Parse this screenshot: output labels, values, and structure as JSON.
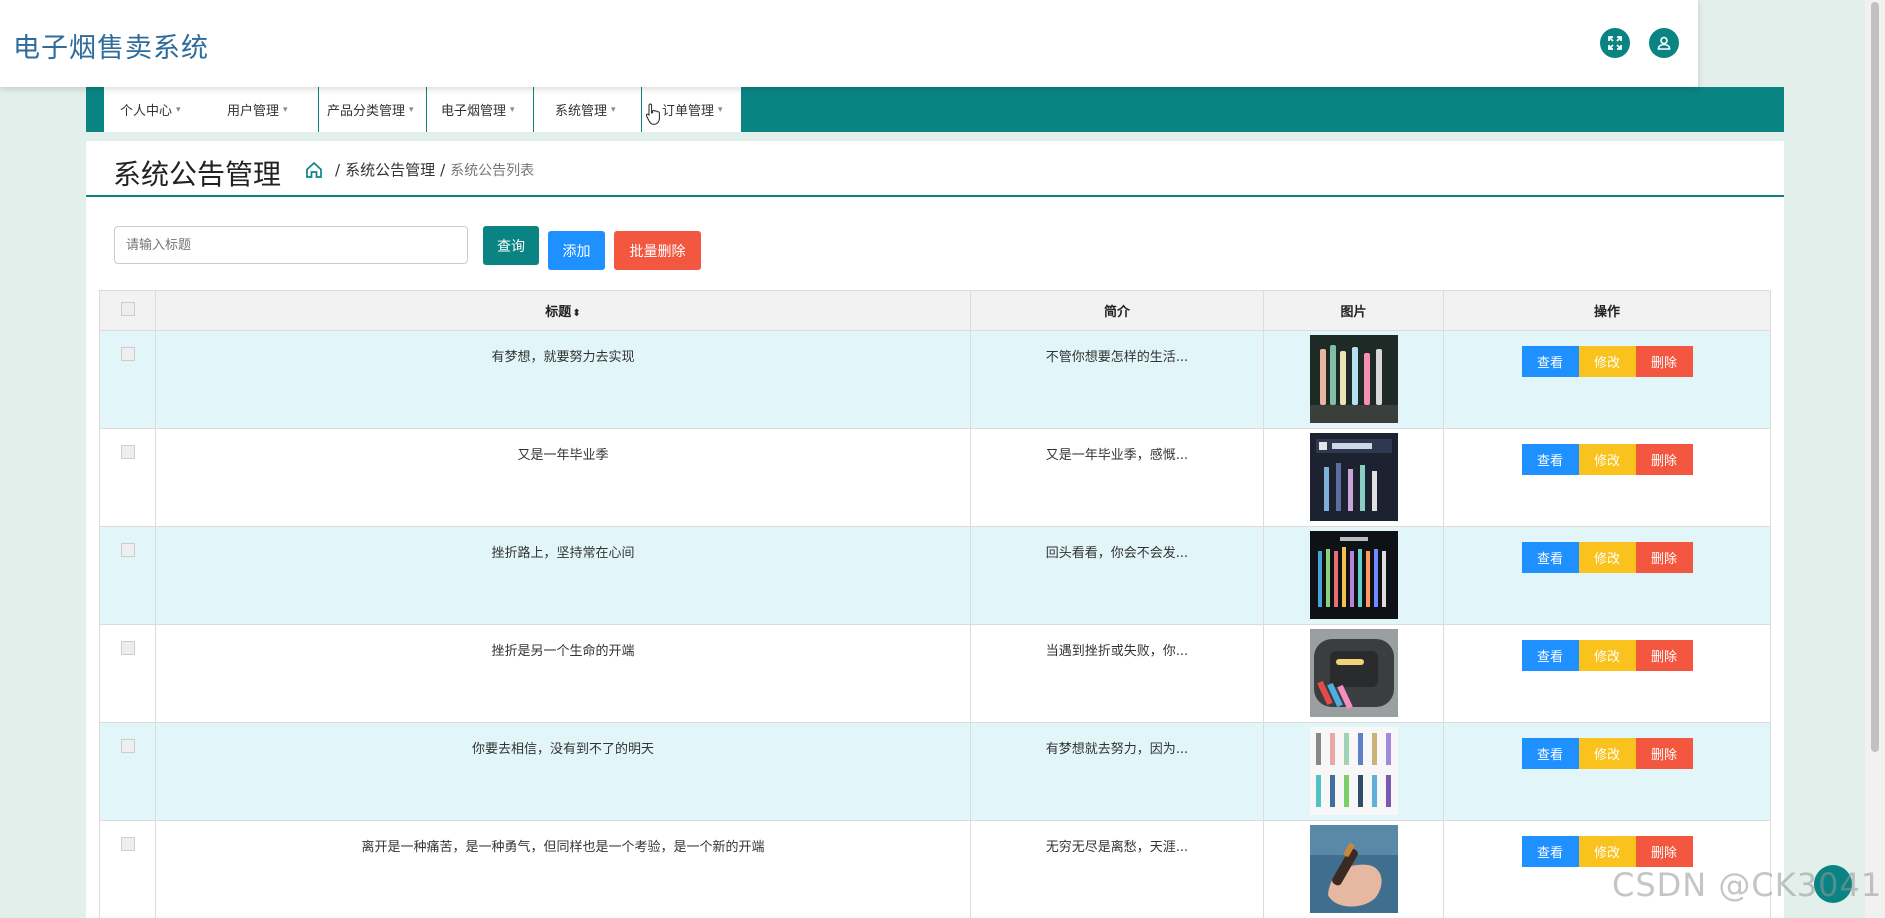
{
  "app": {
    "title": "电子烟售卖系统"
  },
  "nav": {
    "items": [
      "个人中心",
      "用户管理",
      "产品分类管理",
      "电子烟管理",
      "系统管理",
      "订单管理"
    ]
  },
  "page": {
    "title": "系统公告管理",
    "breadcrumb": [
      "系统公告管理",
      "系统公告列表"
    ]
  },
  "toolbar": {
    "search_placeholder": "请输入标题",
    "query_label": "查询",
    "add_label": "添加",
    "batch_delete_label": "批量删除"
  },
  "table": {
    "headers": {
      "title": "标题",
      "intro": "简介",
      "image": "图片",
      "actions": "操作"
    },
    "actions": {
      "view": "查看",
      "edit": "修改",
      "delete": "删除"
    },
    "rows": [
      {
        "title": "有梦想，就要努力去实现",
        "intro": "不管你想要怎样的生活...",
        "image_icon": "vape-pens-photo"
      },
      {
        "title": "又是一年毕业季",
        "intro": "又是一年毕业季，感慨...",
        "image_icon": "vape-product-banner-photo"
      },
      {
        "title": "挫折路上，坚持常在心间",
        "intro": "回头看看，你会不会发...",
        "image_icon": "vape-pens-row-photo"
      },
      {
        "title": "挫折是另一个生命的开端",
        "intro": "当遇到挫折或失败，你...",
        "image_icon": "vape-case-photo"
      },
      {
        "title": "你要去相信，没有到不了的明天",
        "intro": "有梦想就去努力，因为...",
        "image_icon": "vape-colors-grid-photo"
      },
      {
        "title": "离开是一种痛苦，是一种勇气，但同样也是一个考验，是一个新的开端",
        "intro": "无穷无尽是离愁，天涯...",
        "image_icon": "vape-in-hand-photo"
      }
    ]
  },
  "watermark": "CSDN @CK3041",
  "colors": {
    "accent": "#0a8483",
    "blue": "#1e90ff",
    "yellow": "#f9c21d",
    "red": "#f3573f",
    "row_alt": "#e2f5f8"
  }
}
